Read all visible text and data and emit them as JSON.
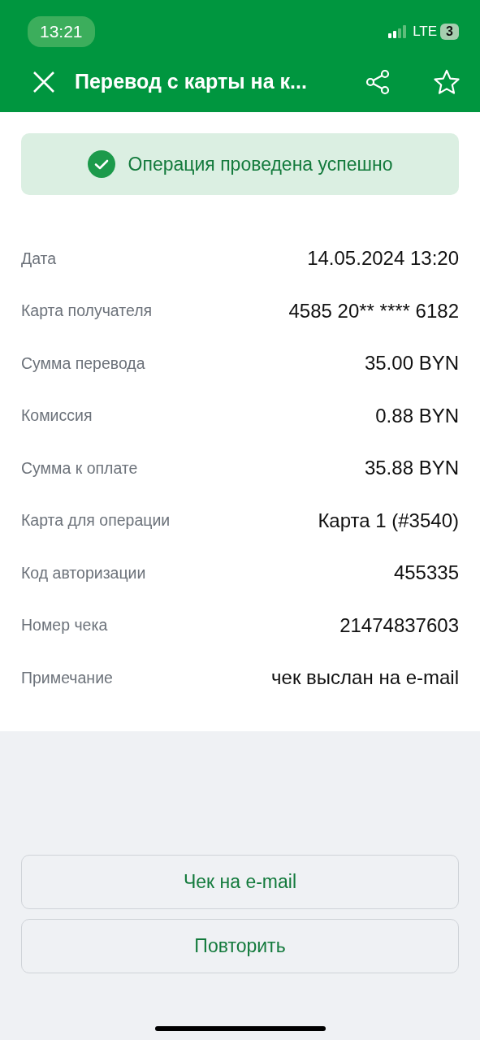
{
  "status_bar": {
    "time": "13:21",
    "network": "LTE",
    "battery": "3"
  },
  "header": {
    "title": "Перевод с карты на к..."
  },
  "banner": {
    "text": "Операция проведена успешно"
  },
  "details": [
    {
      "label": "Дата",
      "value": "14.05.2024 13:20"
    },
    {
      "label": "Карта получателя",
      "value": "4585 20** **** 6182"
    },
    {
      "label": "Сумма перевода",
      "value": "35.00 BYN"
    },
    {
      "label": "Комиссия",
      "value": "0.88 BYN"
    },
    {
      "label": "Сумма к оплате",
      "value": "35.88 BYN"
    },
    {
      "label": "Карта для операции",
      "value": "Карта 1 (#3540)"
    },
    {
      "label": "Код авторизации",
      "value": "455335"
    },
    {
      "label": "Номер чека",
      "value": "21474837603"
    },
    {
      "label": "Примечание",
      "value": "чек выслан на e-mail"
    }
  ],
  "buttons": [
    "Чек на e-mail",
    "Повторить"
  ]
}
